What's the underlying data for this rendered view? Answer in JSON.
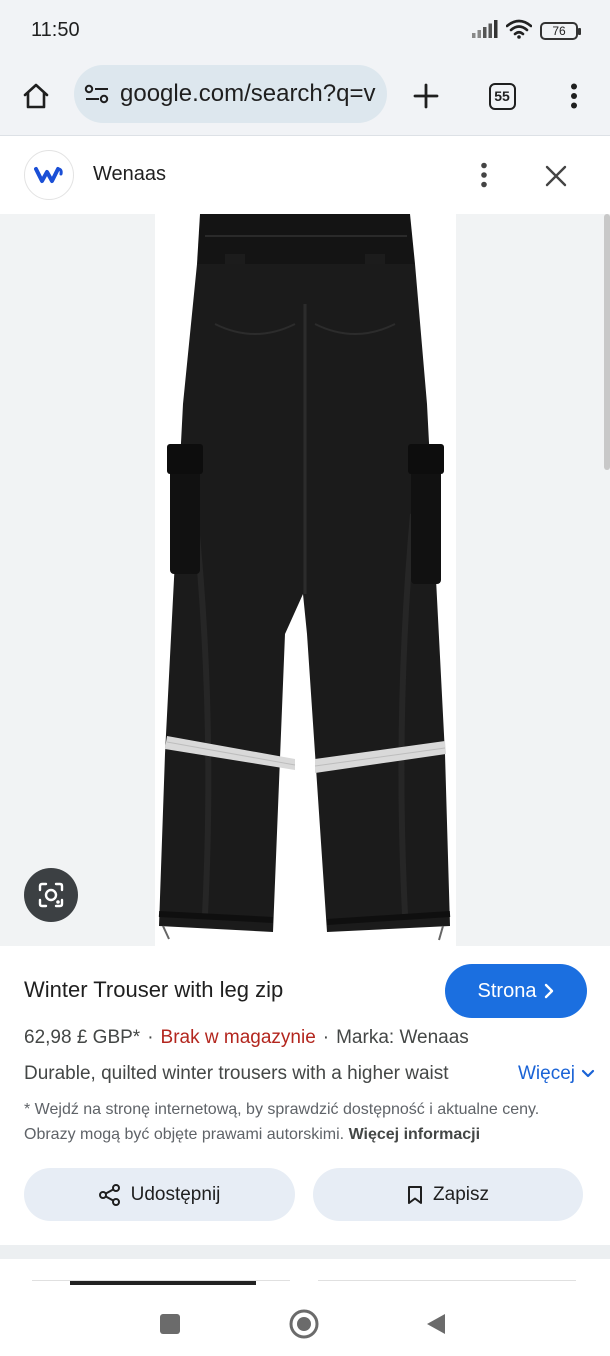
{
  "status_bar": {
    "time": "11:50",
    "battery": "76",
    "icons": [
      "signal-icon",
      "wifi-icon",
      "battery-icon"
    ]
  },
  "browser": {
    "url": "google.com/search?q=v",
    "tab_count": "55",
    "icons": [
      "home-icon",
      "site-info-icon",
      "new-tab-icon",
      "tabs-icon",
      "more-vert-icon"
    ]
  },
  "source": {
    "name": "Wenaas",
    "logo_text": "W",
    "logo_color": "#1a4fd6"
  },
  "product": {
    "title": "Winter Trouser with leg zip",
    "visit_label": "Strona",
    "price": "62,98 £ GBP*",
    "stock": "Brak w magazynie",
    "brand": "Marka: Wenaas",
    "description": "Durable, quilted winter trousers with a higher waist",
    "more_label": "Więcej",
    "disclaimer": "* Wejdź na stronę internetową, by sprawdzić dostępność i aktualne ceny. Obrazy mogą być objęte prawami autorskimi.",
    "disclaimer_link": "Więcej informacji",
    "share_label": "Udostępnij",
    "save_label": "Zapisz"
  },
  "colors": {
    "accent": "#1b6fe0",
    "stock_red": "#b3261e",
    "link_blue": "#1a63d6",
    "chip_bg": "#e7edf5"
  },
  "nav": {
    "icons": [
      "recents-icon",
      "home-circle-icon",
      "back-icon"
    ]
  }
}
